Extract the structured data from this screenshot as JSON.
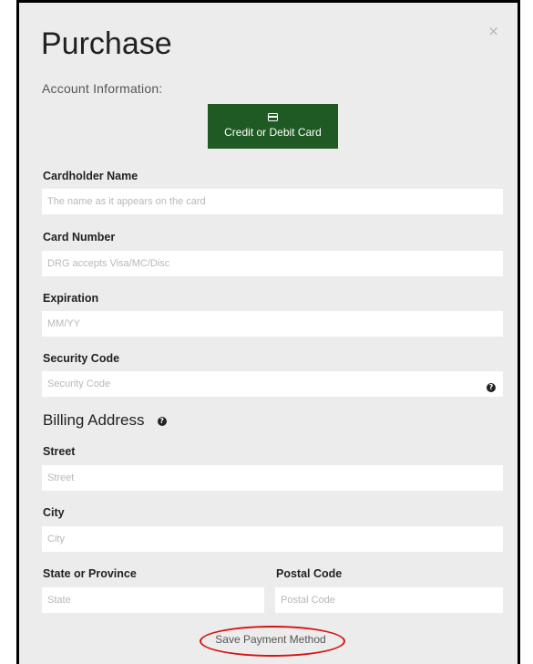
{
  "modal": {
    "title": "Purchase",
    "close_symbol": "×",
    "subtitle": "Account Information:"
  },
  "payment_tab": {
    "icon": "credit-card-icon",
    "label": "Credit or Debit Card"
  },
  "fields": {
    "cardholder_name": {
      "label": "Cardholder Name",
      "placeholder": "The name as it appears on the card",
      "value": ""
    },
    "card_number": {
      "label": "Card Number",
      "placeholder": "DRG accepts Visa/MC/Disc",
      "value": ""
    },
    "expiration": {
      "label": "Expiration",
      "placeholder": "MM/YY",
      "value": ""
    },
    "security_code": {
      "label": "Security Code",
      "placeholder": "Security Code",
      "value": ""
    }
  },
  "billing": {
    "heading": "Billing Address",
    "street": {
      "label": "Street",
      "placeholder": "Street",
      "value": ""
    },
    "city": {
      "label": "City",
      "placeholder": "City",
      "value": ""
    },
    "state": {
      "label": "State or Province",
      "placeholder": "State",
      "value": ""
    },
    "postal": {
      "label": "Postal Code",
      "placeholder": "Postal Code",
      "value": ""
    }
  },
  "help_icon_glyph": "?",
  "save_button": {
    "label": "Save Payment Method"
  },
  "colors": {
    "accent_green": "#1f5a25",
    "annotation_red": "#d8130f",
    "modal_background": "#ececec"
  }
}
